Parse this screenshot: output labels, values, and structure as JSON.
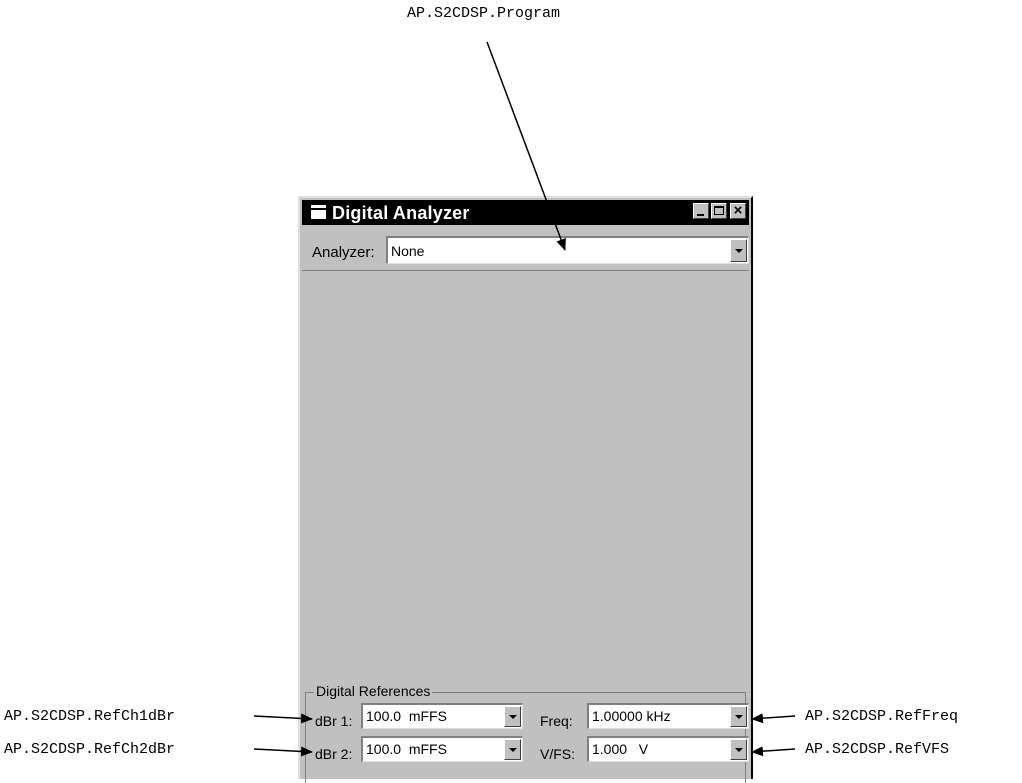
{
  "callouts": {
    "program": "AP.S2CDSP.Program",
    "ref_ch1_dbr": "AP.S2CDSP.RefCh1dBr",
    "ref_ch2_dbr": "AP.S2CDSP.RefCh2dBr",
    "ref_freq": "AP.S2CDSP.RefFreq",
    "ref_vfs": "AP.S2CDSP.RefVFS"
  },
  "window": {
    "title": "Digital Analyzer",
    "analyzer_label": "Analyzer:",
    "analyzer_value": "None"
  },
  "digital_references": {
    "group_label": "Digital References",
    "dbr1_label": "dBr 1:",
    "dbr1_value": "100.0  mFFS",
    "dbr2_label": "dBr 2:",
    "dbr2_value": "100.0  mFFS",
    "freq_label": "Freq:",
    "freq_value": "1.00000 kHz",
    "vfs_label": "V/FS:",
    "vfs_value": "1.000   V"
  },
  "icons": [
    "system-menu-icon",
    "minimize-icon",
    "maximize-icon",
    "close-icon",
    "dropdown-arrow-icon"
  ]
}
